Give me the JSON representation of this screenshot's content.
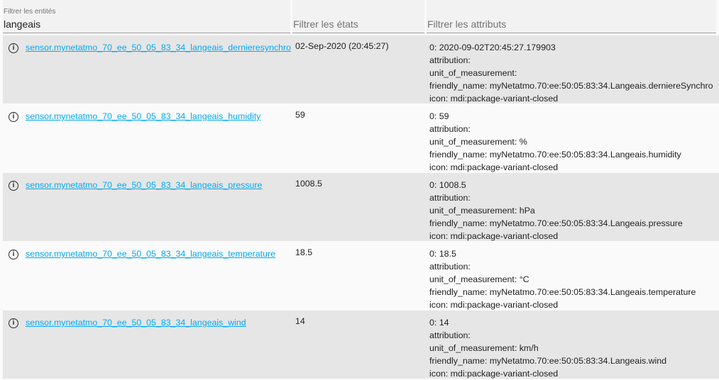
{
  "filters": {
    "entities_label": "Filtrer les entités",
    "entities_value": "langeais",
    "states_placeholder": "Filtrer les états",
    "attributes_placeholder": "Filtrer les attributs"
  },
  "rows": [
    {
      "entity": "sensor.mynetatmo_70_ee_50_05_83_34_langeais_dernieresynchro",
      "state": "02-Sep-2020 (20:45:27)",
      "attributes": [
        "0: 2020-09-02T20:45:27.179903",
        "attribution:",
        "unit_of_measurement:",
        "friendly_name: myNetatmo.70:ee:50:05:83:34.Langeais.derniereSynchro",
        "icon: mdi:package-variant-closed"
      ]
    },
    {
      "entity": "sensor.mynetatmo_70_ee_50_05_83_34_langeais_humidity",
      "state": "59",
      "attributes": [
        "0: 59",
        "attribution:",
        "unit_of_measurement: %",
        "friendly_name: myNetatmo.70:ee:50:05:83:34.Langeais.humidity",
        "icon: mdi:package-variant-closed"
      ]
    },
    {
      "entity": "sensor.mynetatmo_70_ee_50_05_83_34_langeais_pressure",
      "state": "1008.5",
      "attributes": [
        "0: 1008.5",
        "attribution:",
        "unit_of_measurement: hPa",
        "friendly_name: myNetatmo.70:ee:50:05:83:34.Langeais.pressure",
        "icon: mdi:package-variant-closed"
      ]
    },
    {
      "entity": "sensor.mynetatmo_70_ee_50_05_83_34_langeais_temperature",
      "state": "18.5",
      "attributes": [
        "0: 18.5",
        "attribution:",
        "unit_of_measurement: °C",
        "friendly_name: myNetatmo.70:ee:50:05:83:34.Langeais.temperature",
        "icon: mdi:package-variant-closed"
      ]
    },
    {
      "entity": "sensor.mynetatmo_70_ee_50_05_83_34_langeais_wind",
      "state": "14",
      "attributes": [
        "0: 14",
        "attribution:",
        "unit_of_measurement: km/h",
        "friendly_name: myNetatmo.70:ee:50:05:83:34.Langeais.wind",
        "icon: mdi:package-variant-closed"
      ]
    }
  ],
  "icons": {
    "row_icon": "info-circle-icon"
  }
}
